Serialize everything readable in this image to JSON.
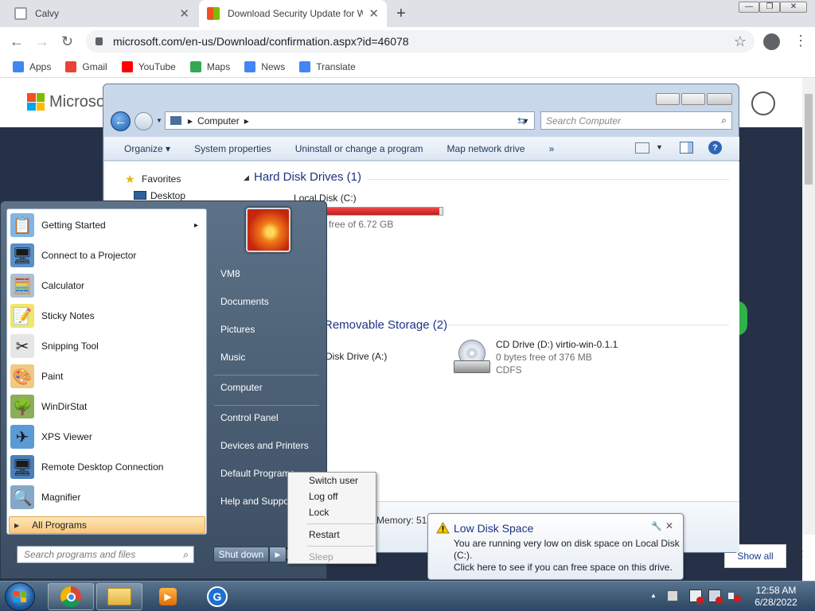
{
  "browser": {
    "tabs": [
      {
        "title": "Calvy",
        "close": "✕"
      },
      {
        "title": "Download Security Update for W",
        "close": "✕"
      }
    ],
    "new_tab": "+",
    "window_controls": {
      "minimize": "—",
      "restore": "❐",
      "close": "✕"
    },
    "nav": {
      "back": "←",
      "forward": "→",
      "reload": "↻"
    },
    "url": "microsoft.com/en-us/Download/confirmation.aspx?id=46078",
    "bookmark_star": "☆",
    "menu_dots": "⋮",
    "bookmarks": [
      {
        "label": "Apps",
        "color": "#4285f4"
      },
      {
        "label": "Gmail",
        "color": "#ea4335"
      },
      {
        "label": "YouTube",
        "color": "#ff0000"
      },
      {
        "label": "Maps",
        "color": "#34a853"
      },
      {
        "label": "News",
        "color": "#4285f4"
      },
      {
        "label": "Translate",
        "color": "#4285f4"
      }
    ]
  },
  "page": {
    "brand": "Microso",
    "show_all": "Show all",
    "dismiss": "✕"
  },
  "explorer": {
    "address": "Computer",
    "search_placeholder": "Search Computer",
    "commands": [
      "Organize ▾",
      "System properties",
      "Uninstall or change a program",
      "Map network drive",
      "»"
    ],
    "nav_tree": [
      {
        "label": "Favorites"
      },
      {
        "label": "Desktop"
      }
    ],
    "sections": [
      {
        "title": "Hard Disk Drives (1)"
      },
      {
        "title": "Removable Storage (2)"
      }
    ],
    "local_disk": {
      "name": "Local Disk (C:)",
      "free": "free of 6.72 GB",
      "used_fraction": 0.98
    },
    "floppy": {
      "name": "Disk Drive (A:)"
    },
    "cd_drive": {
      "name": "CD Drive (D:) virtio-win-0.1.1",
      "free": "0 bytes free of 376 MB",
      "fs": "CDFS"
    },
    "details_memory": "Memory: 512 MB"
  },
  "start_menu": {
    "programs": [
      {
        "label": "Getting Started",
        "icon": "getting-started-icon",
        "glyph": "📋",
        "color": "#7fb6e6",
        "arrow": "▸"
      },
      {
        "label": "Connect to a Projector",
        "icon": "projector-icon",
        "glyph": "🖥",
        "color": "#5b8fc7"
      },
      {
        "label": "Calculator",
        "icon": "calculator-icon",
        "glyph": "🧮",
        "color": "#a9c0d6"
      },
      {
        "label": "Sticky Notes",
        "icon": "sticky-notes-icon",
        "glyph": "📝",
        "color": "#f2e56a"
      },
      {
        "label": "Snipping Tool",
        "icon": "scissors-icon",
        "glyph": "✂",
        "color": "#e6e6e6"
      },
      {
        "label": "Paint",
        "icon": "paint-icon",
        "glyph": "🎨",
        "color": "#f0c986"
      },
      {
        "label": "WinDirStat",
        "icon": "tree-icon",
        "glyph": "🌳",
        "color": "#8cae5a"
      },
      {
        "label": "XPS Viewer",
        "icon": "xps-icon",
        "glyph": "✈",
        "color": "#5a9bd6"
      },
      {
        "label": "Remote Desktop Connection",
        "icon": "remote-desktop-icon",
        "glyph": "🖥",
        "color": "#4c7fb8"
      },
      {
        "label": "Magnifier",
        "icon": "magnifier-icon",
        "glyph": "🔍",
        "color": "#86a8c8"
      }
    ],
    "all_programs": "All Programs",
    "all_programs_arrow": "▶",
    "search_placeholder": "Search programs and files",
    "right_links": [
      "VM8",
      "Documents",
      "Pictures",
      "Music",
      "Computer",
      "Control Panel",
      "Devices and Printers",
      "Default Programs",
      "Help and Support"
    ],
    "shutdown": "Shut down",
    "shutdown_arrow": "▶"
  },
  "shutdown_menu": {
    "items": [
      "Switch user",
      "Log off",
      "Lock",
      "Restart",
      "Sleep"
    ]
  },
  "notification": {
    "title": "Low Disk Space",
    "line1": "You are running very low on disk space on Local Disk",
    "line2": "(C:).",
    "line3": "Click here to see if you can free space on this drive.",
    "close": "✕",
    "pin": "🔧"
  },
  "taskbar": {
    "clock_time": "12:58 AM",
    "clock_date": "6/28/2022",
    "tray_arrow": "▲"
  }
}
